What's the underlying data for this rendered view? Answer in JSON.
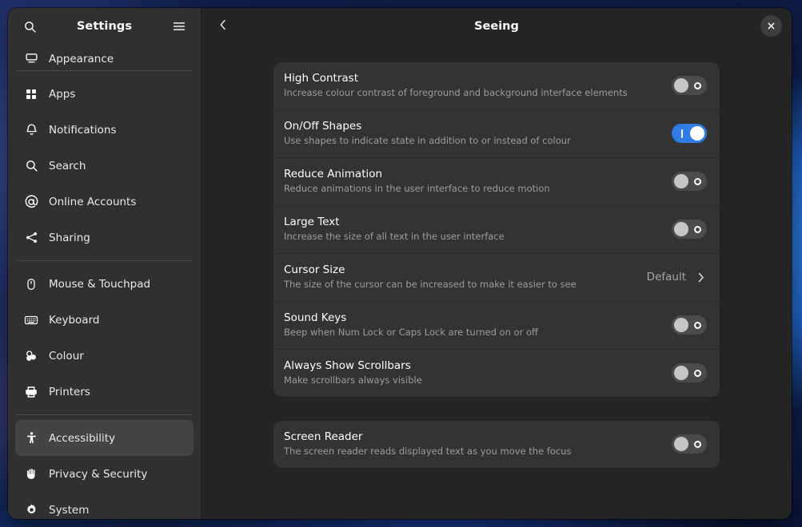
{
  "sidebar": {
    "title": "Settings",
    "search_icon": "search-icon",
    "menu_icon": "hamburger-menu-icon",
    "groups": [
      {
        "items": [
          {
            "label": "Appearance",
            "icon": "appearance-icon",
            "selected": false,
            "partial": true
          }
        ]
      },
      {
        "items": [
          {
            "label": "Apps",
            "icon": "apps-grid-icon",
            "selected": false
          },
          {
            "label": "Notifications",
            "icon": "bell-icon",
            "selected": false
          },
          {
            "label": "Search",
            "icon": "search-icon",
            "selected": false
          },
          {
            "label": "Online Accounts",
            "icon": "at-sign-icon",
            "selected": false
          },
          {
            "label": "Sharing",
            "icon": "share-nodes-icon",
            "selected": false
          }
        ]
      },
      {
        "items": [
          {
            "label": "Mouse & Touchpad",
            "icon": "mouse-icon",
            "selected": false
          },
          {
            "label": "Keyboard",
            "icon": "keyboard-icon",
            "selected": false
          },
          {
            "label": "Colour",
            "icon": "colour-icon",
            "selected": false
          },
          {
            "label": "Printers",
            "icon": "printer-icon",
            "selected": false
          }
        ]
      },
      {
        "items": [
          {
            "label": "Accessibility",
            "icon": "accessibility-person-icon",
            "selected": true
          },
          {
            "label": "Privacy & Security",
            "icon": "hand-icon",
            "selected": false
          },
          {
            "label": "System",
            "icon": "gear-icon",
            "selected": false
          }
        ]
      }
    ]
  },
  "content": {
    "title": "Seeing",
    "back_icon": "chevron-left-icon",
    "close_icon": "close-icon",
    "groups": [
      {
        "rows": [
          {
            "title": "High Contrast",
            "subtitle": "Increase colour contrast of foreground and background interface elements",
            "control": "switch",
            "state": "off"
          },
          {
            "title": "On/Off Shapes",
            "subtitle": "Use shapes to indicate state in addition to or instead of colour",
            "control": "switch",
            "state": "on"
          },
          {
            "title": "Reduce Animation",
            "subtitle": "Reduce animations in the user interface to reduce motion",
            "control": "switch",
            "state": "off"
          },
          {
            "title": "Large Text",
            "subtitle": "Increase the size of all text in the user interface",
            "control": "switch",
            "state": "off"
          },
          {
            "title": "Cursor Size",
            "subtitle": "The size of the cursor can be increased to make it easier to see",
            "control": "value",
            "value": "Default",
            "chevron_icon": "chevron-right-icon"
          },
          {
            "title": "Sound Keys",
            "subtitle": "Beep when Num Lock or Caps Lock are turned on or off",
            "control": "switch",
            "state": "off"
          },
          {
            "title": "Always Show Scrollbars",
            "subtitle": "Make scrollbars always visible",
            "control": "switch",
            "state": "off"
          }
        ]
      },
      {
        "rows": [
          {
            "title": "Screen Reader",
            "subtitle": "The screen reader reads displayed text as you move the focus",
            "control": "switch",
            "state": "off"
          }
        ]
      }
    ]
  },
  "colors": {
    "accent": "#2f7ce5",
    "sidebar_bg": "#303030",
    "content_bg": "#242424",
    "row_bg": "#333333",
    "selected_bg": "#444444"
  }
}
